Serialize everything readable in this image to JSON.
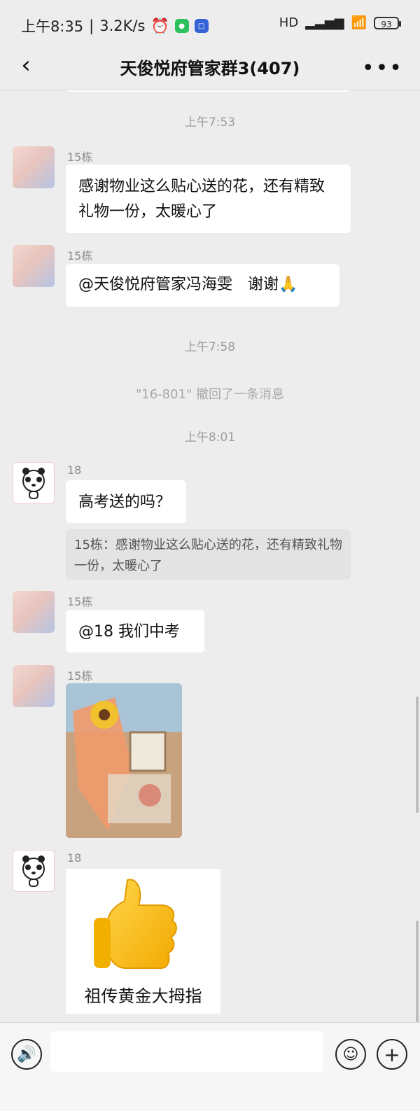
{
  "status": {
    "time": "上午8:35",
    "speed": "3.2K/s",
    "battery": "93",
    "network": "HD"
  },
  "header": {
    "title": "天俊悦府管家群3(407)"
  },
  "chat": {
    "ts1": "上午7:53",
    "ts2": "上午7:58",
    "ts3": "上午8:01",
    "recall": "\"16-801\" 撤回了一条消息",
    "messages": [
      {
        "name": "15栋",
        "text": "感谢物业这么贴心送的花，还有精致礼物一份，太暖心了"
      },
      {
        "name": "15栋",
        "text": "@天俊悦府管家冯海雯　谢谢🙏"
      },
      {
        "name": "18",
        "text": "高考送的吗？",
        "quote": "15栋：感谢物业这么贴心送的花，还有精致礼物一份，太暖心了"
      },
      {
        "name": "15栋",
        "text": "@18  我们中考"
      },
      {
        "name": "15栋",
        "text": ""
      },
      {
        "name": "18",
        "sticker_text": "祖传黄金大拇指"
      }
    ]
  },
  "icons": {
    "back": "chevron-left-icon",
    "more": "more-icon",
    "voice": "voice-icon",
    "emoji": "emoji-icon",
    "plus": "plus-icon"
  }
}
